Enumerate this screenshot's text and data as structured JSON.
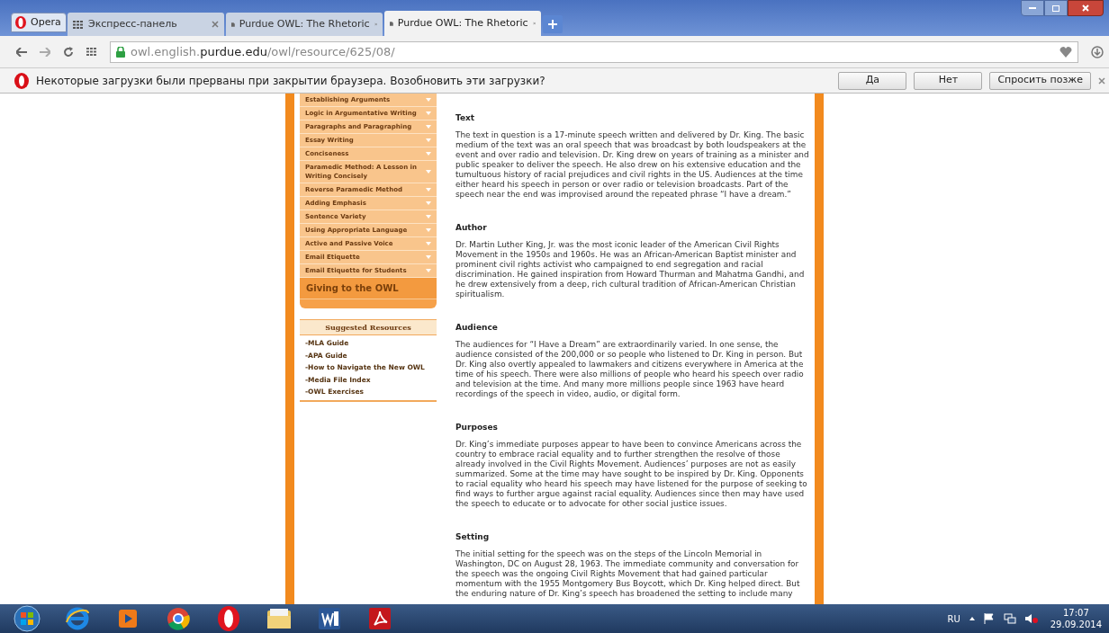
{
  "browser": {
    "menu_label": "Opera",
    "tabs": [
      {
        "title": "Экспресс-панель",
        "kind": "speeddial",
        "selected": false
      },
      {
        "title": "Purdue OWL: The Rhetoric",
        "kind": "page",
        "selected": false
      },
      {
        "title": "Purdue OWL: The Rhetoric",
        "kind": "page",
        "selected": true
      }
    ],
    "address": {
      "prefix": "owl.english.",
      "domain": "purdue.edu",
      "path": "/owl/resource/625/08/"
    },
    "notification": {
      "message": "Некоторые загрузки были прерваны при закрытии браузера. Возобновить эти загрузки?",
      "buttons": [
        "Да",
        "Нет",
        "Спросить позже"
      ]
    }
  },
  "sidebar": {
    "items": [
      {
        "label": "Establishing Arguments",
        "kind": "sub"
      },
      {
        "label": "Logic in Argumentative Writing",
        "kind": "sub"
      },
      {
        "label": "Paragraphs and Paragraphing",
        "kind": "sub"
      },
      {
        "label": "Essay Writing",
        "kind": "sub"
      },
      {
        "label": "Conciseness",
        "kind": "sub"
      },
      {
        "label": "Paramedic Method: A Lesson in Writing Concisely",
        "kind": "sub"
      },
      {
        "label": "Reverse Paramedic Method",
        "kind": "sub"
      },
      {
        "label": "Adding Emphasis",
        "kind": "sub"
      },
      {
        "label": "Sentence Variety",
        "kind": "sub"
      },
      {
        "label": "Using Appropriate Language",
        "kind": "sub"
      },
      {
        "label": "Active and Passive Voice",
        "kind": "sub"
      },
      {
        "label": "Email Etiquette",
        "kind": "sub"
      },
      {
        "label": "Email Etiquette for Students",
        "kind": "sub"
      },
      {
        "label": "Giving to the OWL",
        "kind": "main"
      }
    ],
    "resources": {
      "title": "Suggested Resources",
      "links": [
        "-MLA Guide",
        "-APA Guide",
        "-How to Navigate the New OWL",
        "-Media File Index",
        "-OWL Exercises"
      ]
    }
  },
  "sections": [
    {
      "heading": "Text",
      "body": "The text in question is a 17-minute speech written and delivered by Dr. King. The basic medium of the text was an oral speech that was broadcast by both loudspeakers at the event and over radio and television. Dr. King drew on years of training as a minister and public speaker to deliver the speech. He also drew on his extensive education and the tumultuous history of racial prejudices and civil rights in the US. Audiences at the time either heard his speech in person or over radio or television broadcasts. Part of the speech near the end was improvised around the repeated phrase “I have a dream.”"
    },
    {
      "heading": "Author",
      "body": "Dr. Martin Luther King, Jr. was the most iconic leader of the American Civil Rights Movement in the 1950s and 1960s. He was an African-American Baptist minister and prominent civil rights activist who campaigned to end segregation and racial discrimination. He gained inspiration from Howard Thurman and Mahatma Gandhi, and he drew extensively from a deep, rich cultural tradition of African-American Christian spiritualism."
    },
    {
      "heading": "Audience",
      "body": "The audiences for “I Have a Dream” are extraordinarily varied. In one sense, the audience consisted of the 200,000 or so people who listened to Dr. King in person. But Dr. King also overtly appealed to lawmakers and citizens everywhere in America at the time of his speech. There were also millions of people who heard his speech over radio and television at the time. And many more millions people since 1963 have heard recordings of the speech in video, audio, or digital form."
    },
    {
      "heading": "Purposes",
      "body": "Dr. King’s immediate purposes appear to have been to convince Americans across the country to embrace racial equality and to further strengthen the resolve of those already involved in the Civil Rights Movement. Audiences’ purposes are not as easily summarized. Some at the time may have sought to be inspired by Dr. King. Opponents to racial equality who heard his speech may have listened for the purpose of seeking to find ways to further argue against racial equality. Audiences since then may have used the speech to educate or to advocate for other social justice issues."
    },
    {
      "heading": "Setting",
      "body": "The initial setting for the speech was on the steps of the Lincoln Memorial in Washington, DC on August 28, 1963. The immediate community and conversation for the speech was the ongoing Civil Rights Movement that had gained particular momentum with the 1955 Montgomery Bus Boycott, which Dr. King helped direct. But the enduring nature of Dr. King’s speech has broadened the setting to include many"
    }
  ],
  "taskbar": {
    "apps": [
      {
        "kind": "start"
      },
      {
        "kind": "ie"
      },
      {
        "kind": "media"
      },
      {
        "kind": "chrome"
      },
      {
        "kind": "opera"
      },
      {
        "kind": "explorer"
      },
      {
        "kind": "word"
      },
      {
        "kind": "pdf"
      }
    ],
    "language": "RU",
    "time": "17:07",
    "date": "29.09.2014"
  }
}
